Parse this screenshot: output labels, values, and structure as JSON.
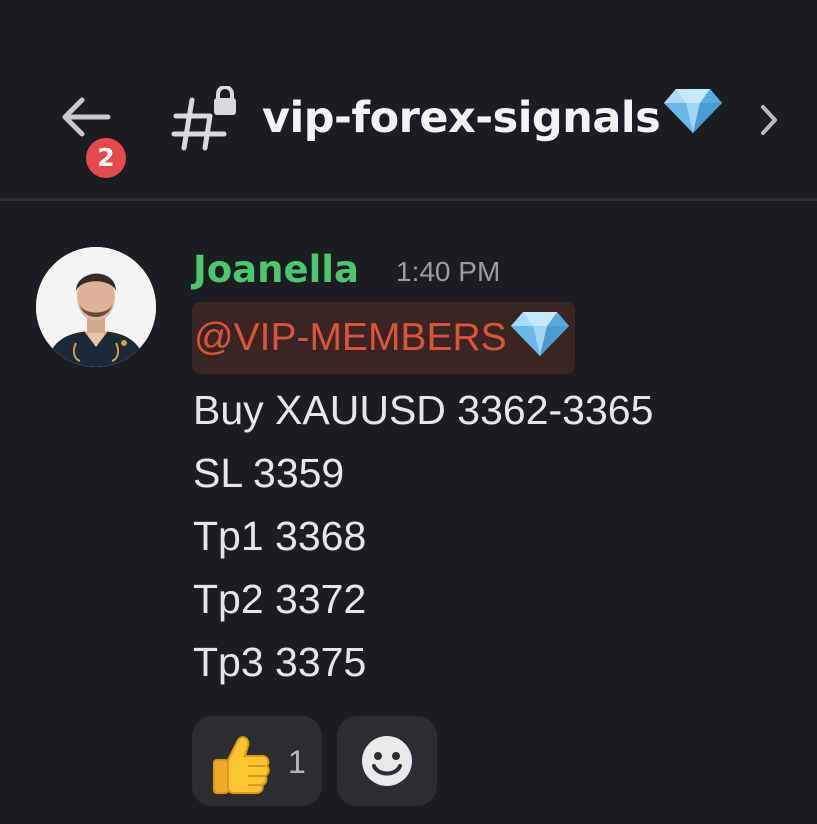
{
  "header": {
    "back_icon": "arrow-left-icon",
    "unread_badge": "2",
    "channel_icon": "locked-hash-icon",
    "channel_name": "vip-forex-signals",
    "channel_emoji": "gem-icon",
    "chevron_icon": "chevron-right-icon"
  },
  "message": {
    "avatar_icon": "user-avatar",
    "author": "Joanella",
    "author_color": "#4cc76d",
    "timestamp": "1:40 PM",
    "mention": "@VIP-MEMBERS",
    "mention_color": "#d9543a",
    "mention_emoji": "gem-icon",
    "lines": [
      "Buy XAUUSD 3362-3365",
      "SL 3359",
      "Tp1 3368",
      "Tp2 3372",
      "Tp3 3375"
    ]
  },
  "reactions": [
    {
      "emoji": "thumbs-up-icon",
      "count": "1"
    },
    {
      "emoji": "add-reaction-smiley-icon",
      "count": ""
    }
  ],
  "colors": {
    "background": "#1c1d21",
    "badge": "#e5484d",
    "reaction_bg": "#2b2d31"
  }
}
